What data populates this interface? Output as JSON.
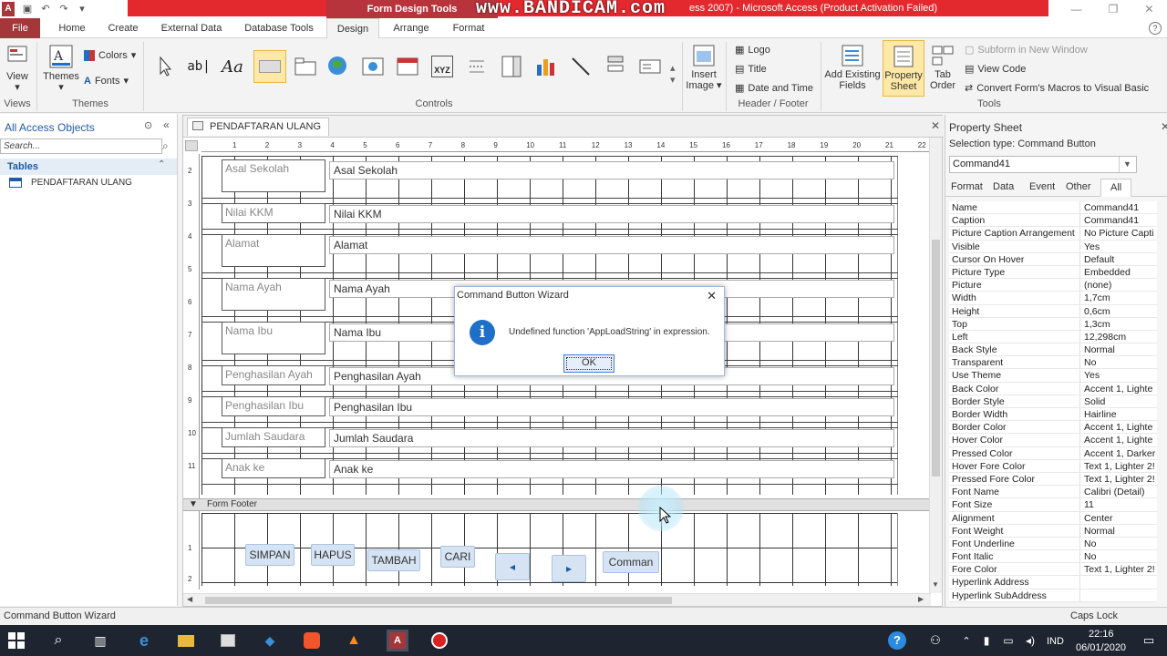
{
  "titlebar": {
    "context_tab": "Form Design Tools",
    "title_text": "ess 2007) - Microsoft Access (Product Activation Failed)",
    "watermark": "www.BANDICAM.com"
  },
  "ribbon_tabs": [
    "File",
    "Home",
    "Create",
    "External Data",
    "Database Tools",
    "Design",
    "Arrange",
    "Format"
  ],
  "ribbon": {
    "view_label": "View",
    "themes_label": "Themes",
    "colors_label": "Colors",
    "fonts_label": "Fonts",
    "insert_image_label": "Insert Image",
    "logo_label": "Logo",
    "title_label": "Title",
    "date_time_label": "Date and Time",
    "add_existing_label": "Add Existing Fields",
    "property_sheet_label": "Property Sheet",
    "tab_order_label": "Tab Order",
    "subform_label": "Subform in New Window",
    "view_code_label": "View Code",
    "convert_macros_label": "Convert Form's Macros to Visual Basic",
    "groups": {
      "views": "Views",
      "themes": "Themes",
      "controls": "Controls",
      "header_footer": "Header / Footer",
      "tools": "Tools"
    },
    "text_box_glyph": "ab|",
    "label_glyph": "Aa",
    "xyz_glyph": "XYZ"
  },
  "nav": {
    "title": "All Access Objects",
    "search_placeholder": "Search...",
    "section": "Tables",
    "items": [
      "PENDAFTARAN ULANG"
    ]
  },
  "document": {
    "tab_label": "PENDAFTARAN ULANG",
    "ruler_top": [
      "1",
      "2",
      "3",
      "4",
      "5",
      "6",
      "7",
      "8",
      "9",
      "10",
      "11",
      "12",
      "13",
      "14",
      "15",
      "16",
      "17",
      "18",
      "19",
      "20",
      "21",
      "22"
    ],
    "ruler_left": [
      "2",
      "3",
      "4",
      "5",
      "6",
      "7",
      "8",
      "9",
      "10",
      "11",
      "1",
      "2"
    ],
    "rows": [
      {
        "label": "Asal Sekolah",
        "field": "Asal Sekolah"
      },
      {
        "label": "Nilai KKM",
        "field": "Nilai KKM"
      },
      {
        "label": "Alamat",
        "field": "Alamat"
      },
      {
        "label": "Nama Ayah",
        "field": "Nama Ayah"
      },
      {
        "label": "Nama Ibu",
        "field": "Nama Ibu"
      },
      {
        "label": "Penghasilan Ayah",
        "field": "Penghasilan Ayah"
      },
      {
        "label": "Penghasilan Ibu",
        "field": "Penghasilan Ibu"
      },
      {
        "label": "Jumlah Saudara",
        "field": "Jumlah Saudara"
      },
      {
        "label": "Anak ke",
        "field": "Anak ke"
      }
    ],
    "footer_section": "Form Footer",
    "footer_buttons": [
      "SIMPAN",
      "HAPUS",
      "TAMBAH",
      "CARI",
      "◂",
      "▸",
      "Comman"
    ]
  },
  "dialog": {
    "title": "Command Button Wizard",
    "message": "Undefined function 'AppLoadString' in expression.",
    "ok_label": "OK"
  },
  "property_sheet": {
    "title": "Property Sheet",
    "selection_type": "Selection type:  Command Button",
    "selected_object": "Command41",
    "tabs": [
      "Format",
      "Data",
      "Event",
      "Other",
      "All"
    ],
    "properties": [
      [
        "Name",
        "Command41"
      ],
      [
        "Caption",
        "Command41"
      ],
      [
        "Picture Caption Arrangement",
        "No Picture Capti"
      ],
      [
        "Visible",
        "Yes"
      ],
      [
        "Cursor On Hover",
        "Default"
      ],
      [
        "Picture Type",
        "Embedded"
      ],
      [
        "Picture",
        "(none)"
      ],
      [
        "Width",
        "1,7cm"
      ],
      [
        "Height",
        "0,6cm"
      ],
      [
        "Top",
        "1,3cm"
      ],
      [
        "Left",
        "12,298cm"
      ],
      [
        "Back Style",
        "Normal"
      ],
      [
        "Transparent",
        "No"
      ],
      [
        "Use Theme",
        "Yes"
      ],
      [
        "Back Color",
        "Accent 1, Lighte"
      ],
      [
        "Border Style",
        "Solid"
      ],
      [
        "Border Width",
        "Hairline"
      ],
      [
        "Border Color",
        "Accent 1, Lighte"
      ],
      [
        "Hover Color",
        "Accent 1, Lighte"
      ],
      [
        "Pressed Color",
        "Accent 1, Darker"
      ],
      [
        "Hover Fore Color",
        "Text 1, Lighter 2!"
      ],
      [
        "Pressed Fore Color",
        "Text 1, Lighter 2!"
      ],
      [
        "Font Name",
        "Calibri (Detail)"
      ],
      [
        "Font Size",
        "11"
      ],
      [
        "Alignment",
        "Center"
      ],
      [
        "Font Weight",
        "Normal"
      ],
      [
        "Font Underline",
        "No"
      ],
      [
        "Font Italic",
        "No"
      ],
      [
        "Fore Color",
        "Text 1, Lighter 2!"
      ],
      [
        "Hyperlink Address",
        ""
      ],
      [
        "Hyperlink SubAddress",
        ""
      ]
    ]
  },
  "statusbar": {
    "left": "Command Button Wizard",
    "caps": "Caps Lock"
  },
  "taskbar": {
    "lang": "IND",
    "time": "22:16",
    "date": "06/01/2020"
  },
  "colors": {
    "access_red": "#a4373a",
    "title_red": "#e3282e",
    "accent_blue": "#1e6fc8",
    "button_fill": "#d5e3f3"
  }
}
